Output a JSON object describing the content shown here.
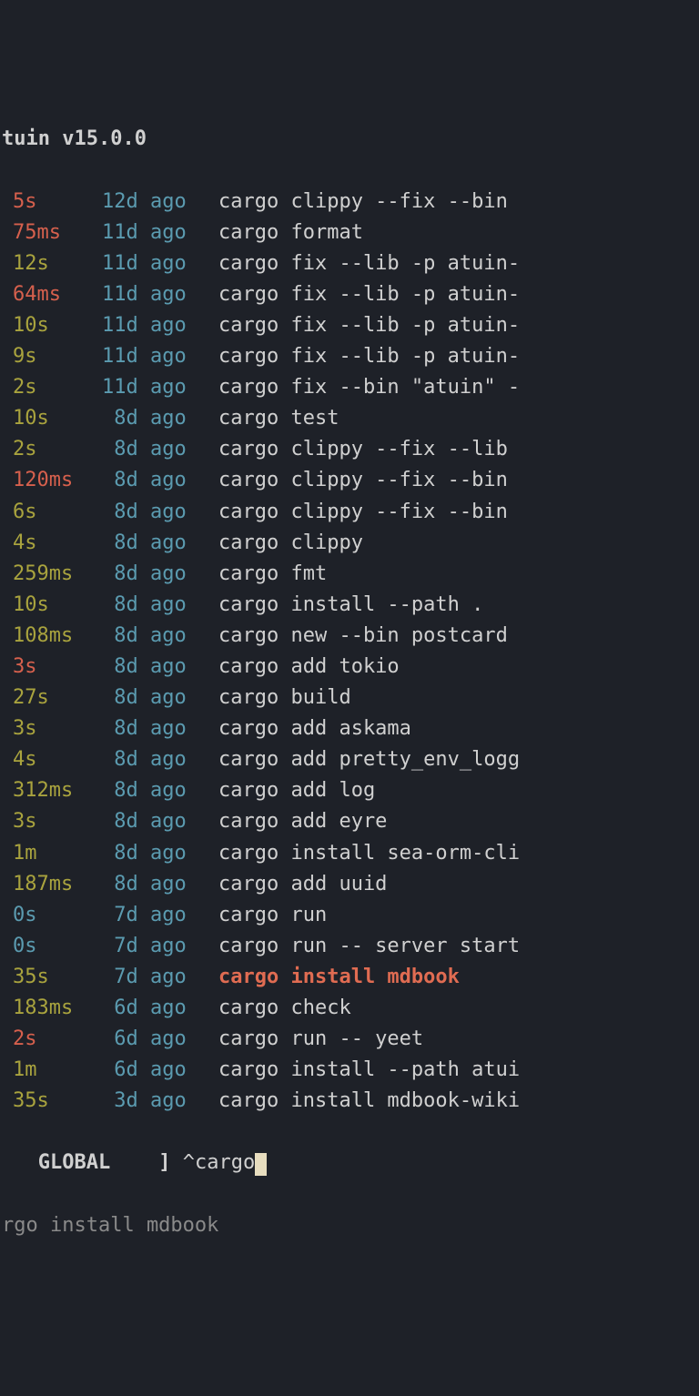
{
  "header": "tuin v15.0.0",
  "rows": [
    {
      "duration": "5s",
      "dur_class": "dur-red",
      "age": "12d ago",
      "cmd": "cargo clippy --fix --bin "
    },
    {
      "duration": "75ms",
      "dur_class": "dur-red",
      "age": "11d ago",
      "cmd": "cargo format"
    },
    {
      "duration": "12s",
      "dur_class": "dur-olive",
      "age": "11d ago",
      "cmd": "cargo fix --lib -p atuin-"
    },
    {
      "duration": "64ms",
      "dur_class": "dur-red",
      "age": "11d ago",
      "cmd": "cargo fix --lib -p atuin-"
    },
    {
      "duration": "10s",
      "dur_class": "dur-olive",
      "age": "11d ago",
      "cmd": "cargo fix --lib -p atuin-"
    },
    {
      "duration": "9s",
      "dur_class": "dur-olive",
      "age": "11d ago",
      "cmd": "cargo fix --lib -p atuin-"
    },
    {
      "duration": "2s",
      "dur_class": "dur-olive",
      "age": "11d ago",
      "cmd": "cargo fix --bin \"atuin\" -"
    },
    {
      "duration": "10s",
      "dur_class": "dur-olive",
      "age": " 8d ago",
      "cmd": "cargo test"
    },
    {
      "duration": "2s",
      "dur_class": "dur-olive",
      "age": " 8d ago",
      "cmd": "cargo clippy --fix --lib "
    },
    {
      "duration": "120ms",
      "dur_class": "dur-red",
      "age": " 8d ago",
      "cmd": "cargo clippy --fix --bin "
    },
    {
      "duration": "6s",
      "dur_class": "dur-olive",
      "age": " 8d ago",
      "cmd": "cargo clippy --fix --bin "
    },
    {
      "duration": "4s",
      "dur_class": "dur-olive",
      "age": " 8d ago",
      "cmd": "cargo clippy"
    },
    {
      "duration": "259ms",
      "dur_class": "dur-olive",
      "age": " 8d ago",
      "cmd": "cargo fmt"
    },
    {
      "duration": "10s",
      "dur_class": "dur-olive",
      "age": " 8d ago",
      "cmd": "cargo install --path ."
    },
    {
      "duration": "108ms",
      "dur_class": "dur-olive",
      "age": " 8d ago",
      "cmd": "cargo new --bin postcard"
    },
    {
      "duration": "3s",
      "dur_class": "dur-red",
      "age": " 8d ago",
      "cmd": "cargo add tokio"
    },
    {
      "duration": "27s",
      "dur_class": "dur-olive",
      "age": " 8d ago",
      "cmd": "cargo build"
    },
    {
      "duration": "3s",
      "dur_class": "dur-olive",
      "age": " 8d ago",
      "cmd": "cargo add askama"
    },
    {
      "duration": "4s",
      "dur_class": "dur-olive",
      "age": " 8d ago",
      "cmd": "cargo add pretty_env_logg"
    },
    {
      "duration": "312ms",
      "dur_class": "dur-olive",
      "age": " 8d ago",
      "cmd": "cargo add log"
    },
    {
      "duration": "3s",
      "dur_class": "dur-olive",
      "age": " 8d ago",
      "cmd": "cargo add eyre"
    },
    {
      "duration": "1m",
      "dur_class": "dur-olive",
      "age": " 8d ago",
      "cmd": "cargo install sea-orm-cli"
    },
    {
      "duration": "187ms",
      "dur_class": "dur-olive",
      "age": " 8d ago",
      "cmd": "cargo add uuid"
    },
    {
      "duration": "0s",
      "dur_class": "dur-teal",
      "age": " 7d ago",
      "cmd": "cargo run"
    },
    {
      "duration": "0s",
      "dur_class": "dur-teal",
      "age": " 7d ago",
      "cmd": "cargo run -- server start"
    },
    {
      "duration": "35s",
      "dur_class": "dur-olive",
      "age": " 7d ago",
      "cmd": "cargo install mdbook",
      "highlight": true
    },
    {
      "duration": "183ms",
      "dur_class": "dur-olive",
      "age": " 6d ago",
      "cmd": "cargo check"
    },
    {
      "duration": "2s",
      "dur_class": "dur-red",
      "age": " 6d ago",
      "cmd": "cargo run -- yeet"
    },
    {
      "duration": "1m",
      "dur_class": "dur-olive",
      "age": " 6d ago",
      "cmd": "cargo install --path atui"
    },
    {
      "duration": "35s",
      "dur_class": "dur-olive",
      "age": " 3d ago",
      "cmd": "cargo install mdbook-wiki"
    }
  ],
  "footer": {
    "scope": "GLOBAL",
    "bracket": "]",
    "query": "^cargo",
    "preview": "rgo install mdbook"
  }
}
